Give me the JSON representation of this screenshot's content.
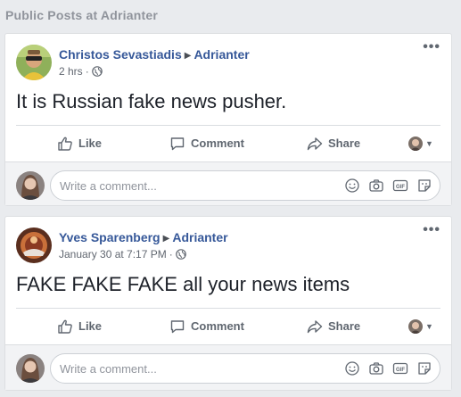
{
  "section_title": "Public Posts at Adrianter",
  "posts": [
    {
      "author": "Christos Sevastiadis",
      "page": "Adrianter",
      "time": "2 hrs",
      "separator": "·",
      "text": "It is Russian fake news pusher.",
      "actions": {
        "like": "Like",
        "comment": "Comment",
        "share": "Share"
      },
      "comment_placeholder": "Write a comment..."
    },
    {
      "author": "Yves Sparenberg",
      "page": "Adrianter",
      "time": "January 30 at 7:17 PM",
      "separator": "·",
      "text": "FAKE FAKE FAKE all your news items",
      "actions": {
        "like": "Like",
        "comment": "Comment",
        "share": "Share"
      },
      "comment_placeholder": "Write a comment..."
    }
  ],
  "colors": {
    "link": "#365899",
    "background": "#e9ebee",
    "muted": "#606770"
  },
  "icons": [
    "globe-icon",
    "like-icon",
    "comment-icon",
    "share-icon",
    "emoji-icon",
    "camera-icon",
    "gif-icon",
    "sticker-icon",
    "more-icon"
  ]
}
